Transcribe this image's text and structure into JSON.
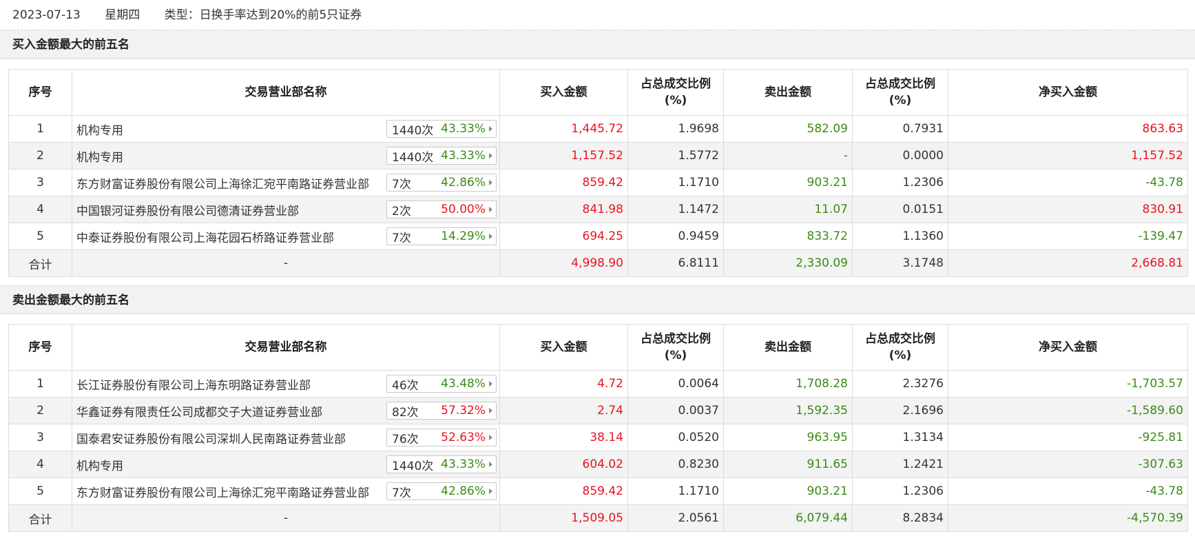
{
  "header": {
    "date": "2023-07-13",
    "weekday": "星期四",
    "type": "类型：日换手率达到20%的前5只证券"
  },
  "columns": {
    "idx": "序号",
    "name": "交易营业部名称",
    "buy": "买入金额",
    "buy_ratio_1": "占总成交比例",
    "buy_ratio_2": "(%)",
    "sell": "卖出金额",
    "sell_ratio_1": "占总成交比例",
    "sell_ratio_2": "(%)",
    "net": "净买入金额"
  },
  "buy_table": {
    "title": "买入金额最大的前五名",
    "rows": [
      {
        "idx": "1",
        "name": "机构专用",
        "count": "1440次",
        "pct": "43.33%",
        "pct_color": "green",
        "buy": "1,445.72",
        "buy_ratio": "1.9698",
        "sell": "582.09",
        "sell_ratio": "0.7931",
        "net": "863.63",
        "net_color": "red"
      },
      {
        "idx": "2",
        "name": "机构专用",
        "count": "1440次",
        "pct": "43.33%",
        "pct_color": "green",
        "buy": "1,157.52",
        "buy_ratio": "1.5772",
        "sell": "-",
        "sell_ratio": "0.0000",
        "net": "1,157.52",
        "net_color": "red"
      },
      {
        "idx": "3",
        "name": "东方财富证券股份有限公司上海徐汇宛平南路证券营业部",
        "count": "7次",
        "pct": "42.86%",
        "pct_color": "green",
        "buy": "859.42",
        "buy_ratio": "1.1710",
        "sell": "903.21",
        "sell_ratio": "1.2306",
        "net": "-43.78",
        "net_color": "green"
      },
      {
        "idx": "4",
        "name": "中国银河证券股份有限公司德清证券营业部",
        "count": "2次",
        "pct": "50.00%",
        "pct_color": "red",
        "buy": "841.98",
        "buy_ratio": "1.1472",
        "sell": "11.07",
        "sell_ratio": "0.0151",
        "net": "830.91",
        "net_color": "red"
      },
      {
        "idx": "5",
        "name": "中泰证券股份有限公司上海花园石桥路证券营业部",
        "count": "7次",
        "pct": "14.29%",
        "pct_color": "green",
        "buy": "694.25",
        "buy_ratio": "0.9459",
        "sell": "833.72",
        "sell_ratio": "1.1360",
        "net": "-139.47",
        "net_color": "green"
      }
    ],
    "total": {
      "label": "合计",
      "name": "-",
      "buy": "4,998.90",
      "buy_ratio": "6.8111",
      "sell": "2,330.09",
      "sell_ratio": "3.1748",
      "net": "2,668.81",
      "net_color": "red"
    }
  },
  "sell_table": {
    "title": "卖出金额最大的前五名",
    "rows": [
      {
        "idx": "1",
        "name": "长江证券股份有限公司上海东明路证券营业部",
        "count": "46次",
        "pct": "43.48%",
        "pct_color": "green",
        "buy": "4.72",
        "buy_ratio": "0.0064",
        "sell": "1,708.28",
        "sell_ratio": "2.3276",
        "net": "-1,703.57",
        "net_color": "green"
      },
      {
        "idx": "2",
        "name": "华鑫证券有限责任公司成都交子大道证券营业部",
        "count": "82次",
        "pct": "57.32%",
        "pct_color": "red",
        "buy": "2.74",
        "buy_ratio": "0.0037",
        "sell": "1,592.35",
        "sell_ratio": "2.1696",
        "net": "-1,589.60",
        "net_color": "green"
      },
      {
        "idx": "3",
        "name": "国泰君安证券股份有限公司深圳人民南路证券营业部",
        "count": "76次",
        "pct": "52.63%",
        "pct_color": "red",
        "buy": "38.14",
        "buy_ratio": "0.0520",
        "sell": "963.95",
        "sell_ratio": "1.3134",
        "net": "-925.81",
        "net_color": "green"
      },
      {
        "idx": "4",
        "name": "机构专用",
        "count": "1440次",
        "pct": "43.33%",
        "pct_color": "green",
        "buy": "604.02",
        "buy_ratio": "0.8230",
        "sell": "911.65",
        "sell_ratio": "1.2421",
        "net": "-307.63",
        "net_color": "green"
      },
      {
        "idx": "5",
        "name": "东方财富证券股份有限公司上海徐汇宛平南路证券营业部",
        "count": "7次",
        "pct": "42.86%",
        "pct_color": "green",
        "buy": "859.42",
        "buy_ratio": "1.1710",
        "sell": "903.21",
        "sell_ratio": "1.2306",
        "net": "-43.78",
        "net_color": "green"
      }
    ],
    "total": {
      "label": "合计",
      "name": "-",
      "buy": "1,509.05",
      "buy_ratio": "2.0561",
      "sell": "6,079.44",
      "sell_ratio": "8.2834",
      "net": "-4,570.39",
      "net_color": "green"
    }
  }
}
